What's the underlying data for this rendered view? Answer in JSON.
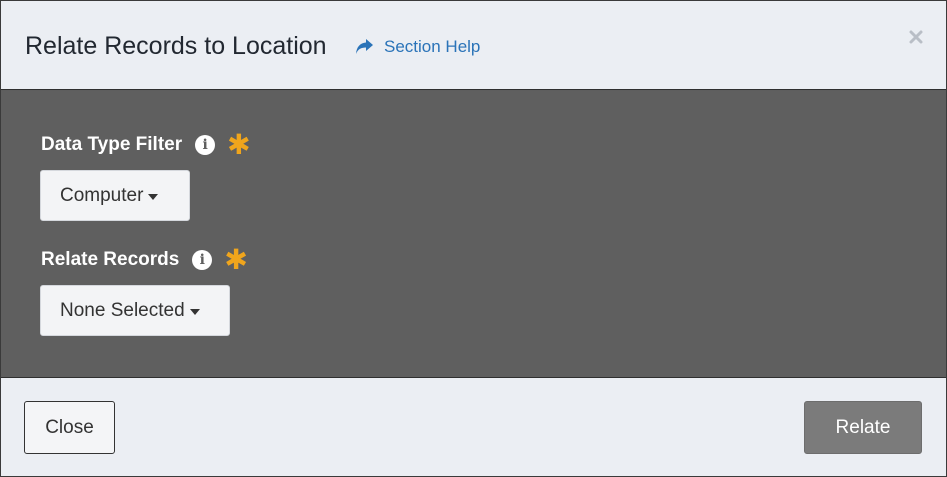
{
  "dialog": {
    "title": "Relate Records to Location",
    "section_help_label": "Section Help",
    "close_symbol": "×"
  },
  "fields": [
    {
      "label": "Data Type Filter",
      "info_icon": "i",
      "required_marker": "✱",
      "selected": "Computer"
    },
    {
      "label": "Relate Records",
      "info_icon": "i",
      "required_marker": "✱",
      "selected": "None Selected"
    }
  ],
  "footer": {
    "close_label": "Close",
    "relate_label": "Relate"
  },
  "colors": {
    "header_bg": "#ebeef3",
    "body_bg": "#5f5f5f",
    "link": "#2a73b8",
    "required": "#f0a51c",
    "relate_button": "#7b7b7b"
  }
}
